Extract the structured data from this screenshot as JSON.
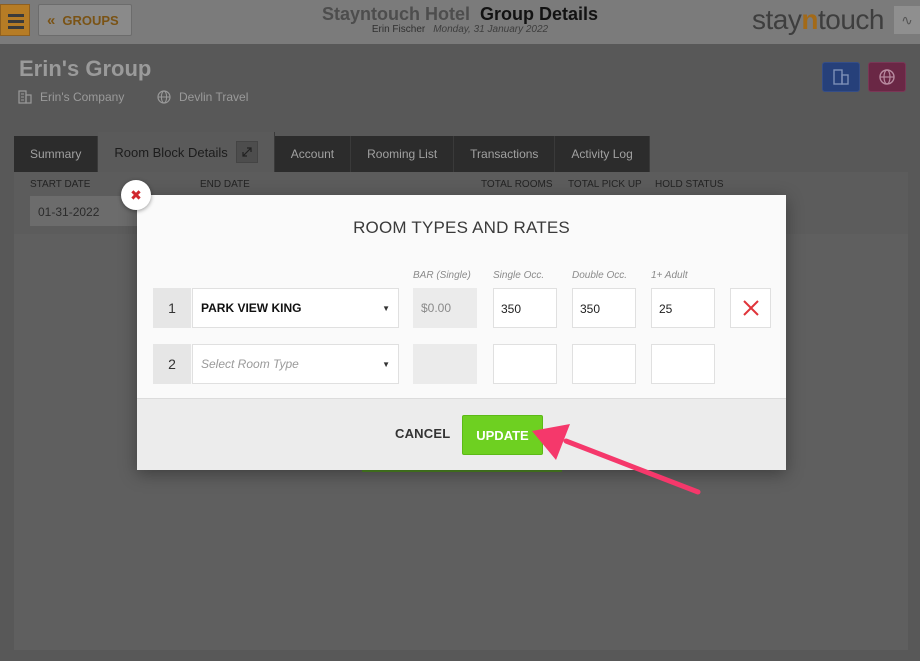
{
  "header": {
    "groups_label": "GROUPS",
    "hotel_name": "Stayntouch Hotel",
    "page_title": "Group Details",
    "user_name": "Erin Fischer",
    "date": "Monday, 31 January 2022",
    "logo_left": "stay",
    "logo_n": "n",
    "logo_right": "touch"
  },
  "group": {
    "name": "Erin's Group",
    "company": "Erin's Company",
    "travel_agent": "Devlin Travel"
  },
  "tabs": [
    {
      "label": "Summary"
    },
    {
      "label": "Room Block Details"
    },
    {
      "label": "Account"
    },
    {
      "label": "Rooming List"
    },
    {
      "label": "Transactions"
    },
    {
      "label": "Activity Log"
    }
  ],
  "block": {
    "start_date_label": "START DATE",
    "end_date_label": "END DATE",
    "total_rooms_label": "TOTAL ROOMS",
    "total_pickup_label": "TOTAL PICK UP",
    "hold_status_label": "HOLD STATUS",
    "start_date_value": "01-31-2022"
  },
  "modal": {
    "title": "ROOM TYPES AND RATES",
    "columns": {
      "bar": "BAR (Single)",
      "single": "Single Occ.",
      "double": "Double Occ.",
      "extra": "1+ Adult"
    },
    "rows": [
      {
        "num": "1",
        "room_type": "PARK VIEW KING",
        "bar": "$0.00",
        "single": "350",
        "double": "350",
        "extra": "25"
      },
      {
        "num": "2",
        "placeholder": "Select Room Type",
        "bar": "",
        "single": "",
        "double": "",
        "extra": ""
      }
    ],
    "cancel_label": "CANCEL",
    "update_label": "UPDATE"
  },
  "colors": {
    "accent": "#f0a32f",
    "update_green": "#6ed021",
    "close_red": "#d0272d",
    "annotation_arrow": "#f5386b"
  }
}
